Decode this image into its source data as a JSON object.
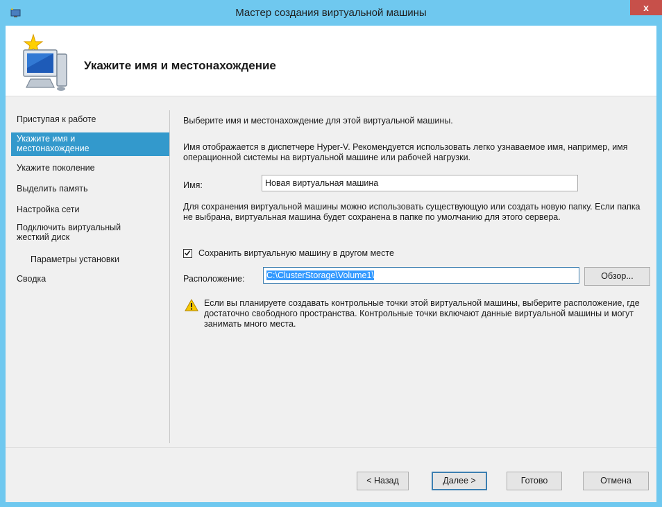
{
  "window": {
    "title": "Мастер создания виртуальной машины",
    "close_label": "x"
  },
  "header": {
    "title": "Укажите имя и местонахождение"
  },
  "nav": {
    "items": [
      {
        "label": "Приступая к работе",
        "active": false
      },
      {
        "label": "Укажите имя и\nместонахождение",
        "active": true
      },
      {
        "label": "Укажите поколение",
        "active": false
      },
      {
        "label": "Выделить память",
        "active": false
      },
      {
        "label": "Настройка сети",
        "active": false
      },
      {
        "label": "Подключить виртуальный\nжесткий диск",
        "active": false
      },
      {
        "label": "Параметры установки",
        "active": false
      },
      {
        "label": "Сводка",
        "active": false
      }
    ]
  },
  "content": {
    "intro": "Выберите имя и местонахождение для этой виртуальной машины.",
    "name_hint": "Имя отображается в диспетчере Hyper-V. Рекомендуется использовать легко узнаваемое имя, например, имя операционной системы на виртуальной машине или рабочей нагрузки.",
    "name_label": "Имя:",
    "name_value": "Новая виртуальная машина",
    "location_hint": "Для сохранения виртуальной машины можно использовать существующую или создать новую папку. Если папка не выбрана, виртуальная машина будет сохранена в папке по умолчанию для этого сервера.",
    "store_elsewhere_label": "Сохранить виртуальную машину в другом месте",
    "store_elsewhere_checked": true,
    "location_label": "Расположение:",
    "location_value": "C:\\ClusterStorage\\Volume1\\",
    "browse_label": "Обзор...",
    "warning_text": "Если вы планируете создавать контрольные точки этой виртуальной машины, выберите расположение, где достаточно свободного пространства. Контрольные точки включают данные виртуальной машины и могут занимать много места."
  },
  "footer": {
    "back_label": "< Назад",
    "next_label": "Далее >",
    "finish_label": "Готово",
    "cancel_label": "Отмена"
  },
  "colors": {
    "title_bar": "#6fc8ef",
    "nav_active": "#3399cc",
    "close_button": "#c7504a",
    "text_selection": "#3399ff"
  }
}
